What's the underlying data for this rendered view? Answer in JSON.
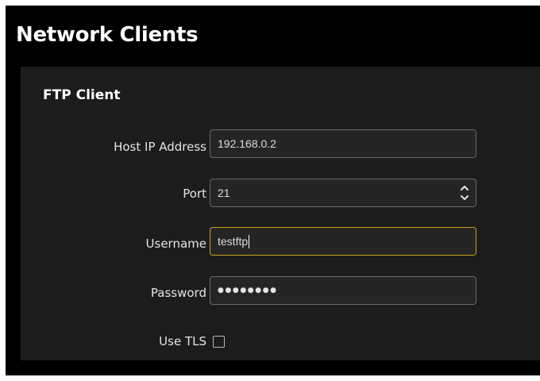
{
  "header": {
    "title": "Network Clients"
  },
  "ftp": {
    "section_title": "FTP Client",
    "host": {
      "label": "Host IP Address",
      "value": "192.168.0.2"
    },
    "port": {
      "label": "Port",
      "value": "21"
    },
    "username": {
      "label": "Username",
      "value": "testftp"
    },
    "password": {
      "label": "Password",
      "masked_value": "●●●●●●●●"
    },
    "use_tls": {
      "label": "Use TLS",
      "checked": false
    }
  },
  "colors": {
    "background": "#000000",
    "panel": "#1c1c1c",
    "input_background": "#252525",
    "input_border": "#6a6a6a",
    "focus_border": "#d1a021",
    "text": "#e4e4e4"
  },
  "icons": {
    "port_spinner": "up-down-arrows-icon"
  }
}
